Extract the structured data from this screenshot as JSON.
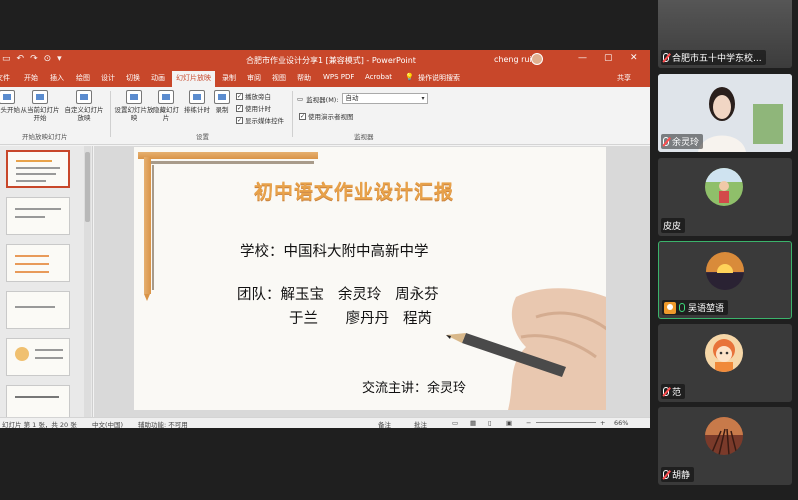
{
  "ppt": {
    "quick_access": [
      "▭",
      "↶",
      "↷",
      "⊙",
      "▾"
    ],
    "doc_title": "合肥市作业设计分享1 [兼容模式] - PowerPoint",
    "user_name": "cheng rui",
    "window_controls": [
      "—",
      "▢",
      "✕"
    ],
    "tabs": [
      "文件",
      "开始",
      "插入",
      "绘图",
      "设计",
      "切换",
      "动画",
      "幻灯片放映",
      "录制",
      "审阅",
      "视图",
      "帮助",
      "WPS PDF",
      "Acrobat",
      "操作说明搜索"
    ],
    "active_tab": "幻灯片放映",
    "share_label": "共享",
    "ribbon": {
      "from_start": "从头开始",
      "from_current": "从当前幻灯片开始",
      "custom_show": "自定义幻灯片放映",
      "group_start": "开始放映幻灯片",
      "setup_show": "设置幻灯片放映",
      "hide_slide": "隐藏幻灯片",
      "rehearse": "排练计时",
      "record": "录制",
      "group_setup": "设置",
      "cb_narration": "播放旁白",
      "cb_timings": "使用计时",
      "cb_media": "显示媒体控件",
      "monitor_label": "监视器(M):",
      "monitor_value": "自动",
      "cb_presenter": "使用演示者视图",
      "group_monitor": "监视器"
    },
    "slide": {
      "title": "初中语文作业设计汇报",
      "school": "学校：中国科大附中高新中学",
      "team_line1": "团队：解玉宝   余灵玲   周永芬",
      "team_line2": "于兰      廖丹丹   程芮",
      "speaker": "交流主讲：余灵玲"
    },
    "status": {
      "slide_count": "幻灯片 第 1 张，共 20 张",
      "language": "中文(中国)",
      "accessibility": "辅助功能: 不可用",
      "notes": "备注",
      "comments": "批注",
      "zoom": "66%"
    }
  },
  "participants": [
    {
      "name": "合肥市五十中学东校...",
      "mic": "muted"
    },
    {
      "name": "余灵玲",
      "mic": "muted"
    },
    {
      "name": "皮皮",
      "mic": "none"
    },
    {
      "name": "吴语堃语",
      "mic": "on",
      "host": true
    },
    {
      "name": "范",
      "mic": "muted"
    },
    {
      "name": "胡静",
      "mic": "muted"
    }
  ],
  "colors": {
    "ppt_accent": "#c8472a",
    "title_orange": "#e8a24a",
    "talking": "#3bb36b"
  }
}
